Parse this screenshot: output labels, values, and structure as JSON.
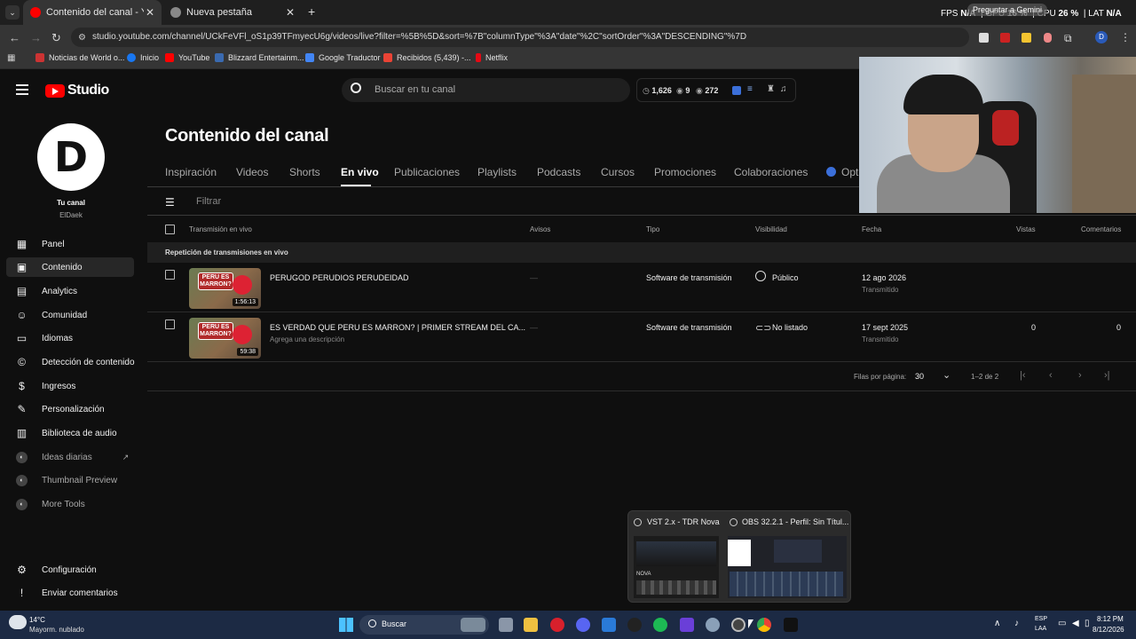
{
  "browser": {
    "tabs": [
      {
        "title": "Contenido del canal - YouTube",
        "active": true
      },
      {
        "title": "Nueva pestaña",
        "active": false
      }
    ],
    "overlay_left": "FPS",
    "overlay_na1": "N/A",
    "overlay_gpu": "GPU",
    "overlay_gpu_val": "16 %",
    "overlay_cpu": "CPU",
    "overlay_cpu_val": "26 %",
    "overlay_lat": "LAT",
    "overlay_lat_val": "N/A",
    "gemini_tooltip": "Preguntar a Gemini",
    "url": "studio.youtube.com/channel/UCkFeVFl_oS1p39TFmyecU6g/videos/live?filter=%5B%5D&sort=%7B\"columnType\"%3A\"date\"%2C\"sortOrder\"%3A\"DESCENDING\"%7D",
    "bookmarks": [
      {
        "label": "Noticias de World o...",
        "color": "#c33"
      },
      {
        "label": "Inicio",
        "color": "#1877f2"
      },
      {
        "label": "YouTube",
        "color": "#f00"
      },
      {
        "label": "Blizzard Entertainm...",
        "color": "#3a6ab0"
      },
      {
        "label": "Google Traductor",
        "color": "#4285f4"
      },
      {
        "label": "Recibidos (5,439) -...",
        "color": "#ea4335"
      },
      {
        "label": "Netflix",
        "color": "#e50914"
      }
    ]
  },
  "studio": {
    "logo_text": "Studio",
    "search_placeholder": "Buscar en tu canal",
    "stats": {
      "a": "1,626",
      "b": "9",
      "c": "272"
    },
    "channel": {
      "label": "Tu canal",
      "name": "ElDaek"
    },
    "sidebar": [
      {
        "label": "Panel",
        "icon": "dashboard-icon"
      },
      {
        "label": "Contenido",
        "icon": "content-icon"
      },
      {
        "label": "Analytics",
        "icon": "analytics-icon"
      },
      {
        "label": "Comunidad",
        "icon": "community-icon"
      },
      {
        "label": "Idiomas",
        "icon": "subtitles-icon"
      },
      {
        "label": "Detección de contenido",
        "icon": "copyright-icon"
      },
      {
        "label": "Ingresos",
        "icon": "dollar-icon"
      },
      {
        "label": "Personalización",
        "icon": "wand-icon"
      },
      {
        "label": "Biblioteca de audio",
        "icon": "audio-library-icon"
      },
      {
        "label": "Ideas diarias",
        "icon": "extension-icon"
      },
      {
        "label": "Thumbnail Preview",
        "icon": "extension-icon"
      },
      {
        "label": "More Tools",
        "icon": "extension-icon"
      }
    ],
    "sidebar_bottom": [
      {
        "label": "Configuración",
        "icon": "gear-icon"
      },
      {
        "label": "Enviar comentarios",
        "icon": "feedback-icon"
      }
    ],
    "page_title": "Contenido del canal",
    "tabs": [
      "Inspiración",
      "Videos",
      "Shorts",
      "En vivo",
      "Publicaciones",
      "Playlists",
      "Podcasts",
      "Cursos",
      "Promociones",
      "Colaboraciones",
      "Opti"
    ],
    "active_tab": "En vivo",
    "filter_placeholder": "Filtrar",
    "columns": [
      "Transmisión en vivo",
      "Avisos",
      "Tipo",
      "Visibilidad",
      "Fecha",
      "Vistas",
      "Comentarios"
    ],
    "section_label": "Repetición de transmisiones en vivo",
    "rows": [
      {
        "title": "PERUGOD PERUDIOS PERUDEIDAD",
        "desc": "",
        "duration": "1:56:13",
        "thumb_text": "PERU ES MARRON?",
        "avisos": "—",
        "tipo": "Software de transmisión",
        "visibilidad": "Público",
        "fecha": "12 ago 2026",
        "fecha_sub": "Transmitido",
        "vistas": "",
        "comentarios": ""
      },
      {
        "title": "ES VERDAD QUE PERU ES MARRON? | PRIMER STREAM DEL CA...",
        "desc": "Agrega una descripción",
        "duration": "59:38",
        "thumb_text": "PERU ES MARRON?",
        "avisos": "—",
        "tipo": "Software de transmisión",
        "visibilidad": "No listado",
        "fecha": "17 sept 2025",
        "fecha_sub": "Transmitido",
        "vistas": "0",
        "comentarios": "0"
      }
    ],
    "pagination": {
      "rows_label": "Filas por página:",
      "rows_value": "30",
      "range": "1–2 de 2"
    }
  },
  "taskbar": {
    "weather_temp": "14°C",
    "weather_desc": "Mayorm. nublado",
    "search": "Buscar",
    "lang1": "ESP",
    "lang2": "LAA",
    "time": "8:12 PM",
    "date": "8/12/2026",
    "preview_windows": [
      {
        "title": "VST 2.x - TDR Nova"
      },
      {
        "title": "OBS 32.2.1 - Perfil: Sin Títul..."
      }
    ],
    "nova_label": "NOVA"
  }
}
